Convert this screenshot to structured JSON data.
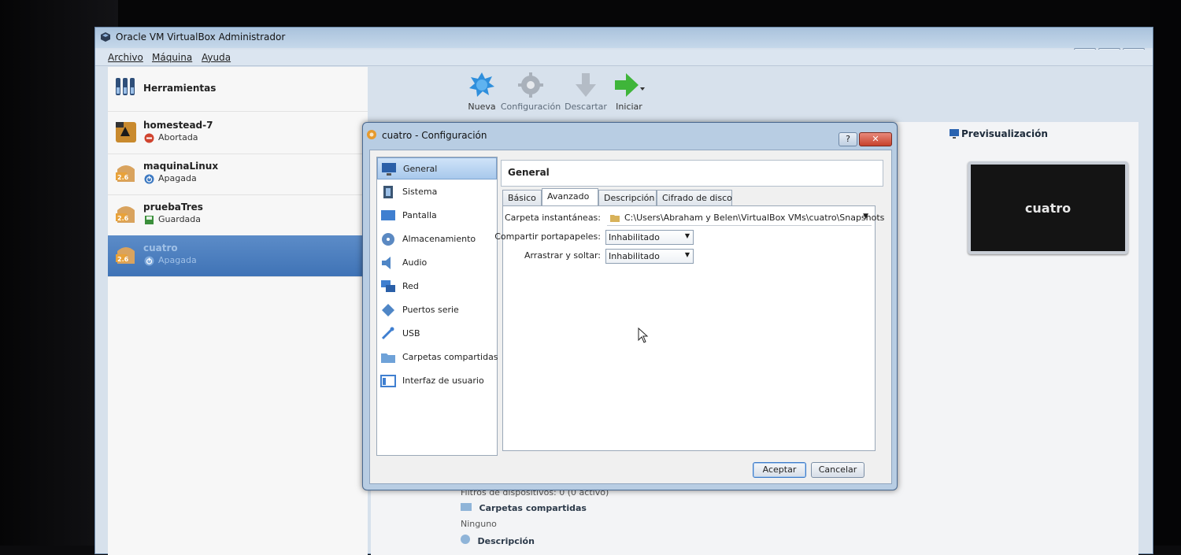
{
  "window": {
    "title": "Oracle VM VirtualBox Administrador",
    "menu": [
      "Archivo",
      "Máquina",
      "Ayuda"
    ],
    "controls": [
      "▭",
      "⊟",
      "✕"
    ]
  },
  "tools": {
    "label": "Herramientas"
  },
  "vms": [
    {
      "name": "homestead-7",
      "state": "Abortada",
      "version": ""
    },
    {
      "name": "maquinaLinux",
      "state": "Apagada",
      "version": "2.6"
    },
    {
      "name": "pruebaTres",
      "state": "Guardada",
      "version": "2.6"
    },
    {
      "name": "cuatro",
      "state": "Apagada",
      "version": "2.6"
    }
  ],
  "toolbar": {
    "nueva": "Nueva",
    "configuracion": "Configuración",
    "descartar": "Descartar",
    "iniciar": "Iniciar"
  },
  "preview": {
    "header": "Previsualización",
    "vm_name": "cuatro"
  },
  "details": {
    "filtros_label": "Filtros de dispositivos:",
    "filtros_value": "0 (0 activo)",
    "shared_header": "Carpetas compartidas",
    "shared_value": "Ninguno",
    "desc_header": "Descripción"
  },
  "dialog": {
    "title": "cuatro - Configuración",
    "help": "?",
    "close": "✕",
    "sidebar": [
      "General",
      "Sistema",
      "Pantalla",
      "Almacenamiento",
      "Audio",
      "Red",
      "Puertos serie",
      "USB",
      "Carpetas compartidas",
      "Interfaz de usuario"
    ],
    "section_title": "General",
    "tabs": [
      "Básico",
      "Avanzado",
      "Descripción",
      "Cifrado de disco"
    ],
    "active_tab": "Avanzado",
    "fields": {
      "snapshot_label": "Carpeta instantáneas:",
      "snapshot_path": "C:\\Users\\Abraham y Belen\\VirtualBox VMs\\cuatro\\Snapshots",
      "clipboard_label": "Compartir portapapeles:",
      "clipboard_value": "Inhabilitado",
      "dragdrop_label": "Arrastrar y soltar:",
      "dragdrop_value": "Inhabilitado"
    },
    "buttons": {
      "ok": "Aceptar",
      "cancel": "Cancelar"
    }
  },
  "colors": {
    "selection": "#3f73b6",
    "dialog_frame": "#b8cde3",
    "close_red": "#c7412c"
  }
}
